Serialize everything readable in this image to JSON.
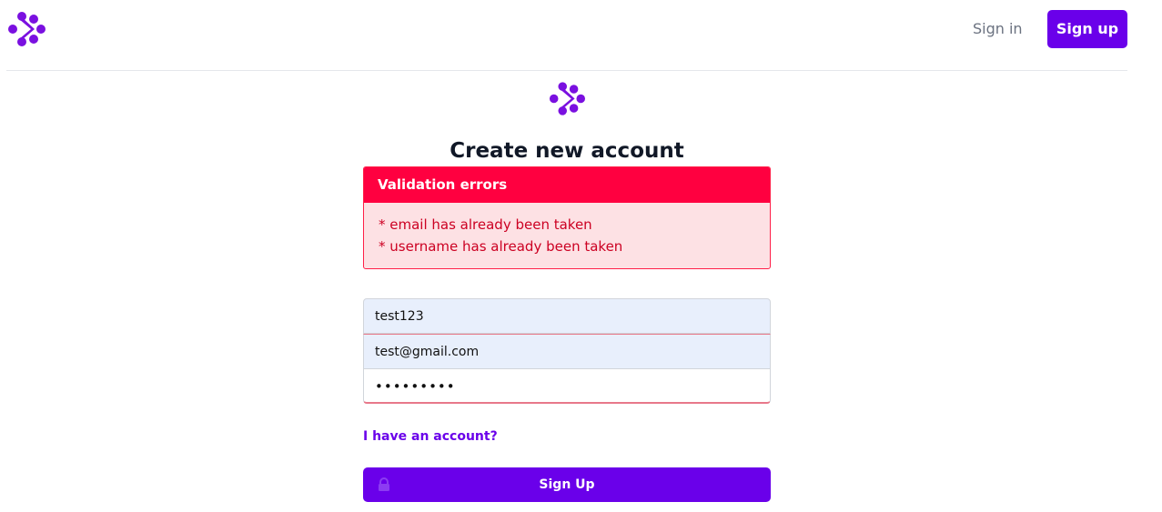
{
  "header": {
    "signin_label": "Sign in",
    "signup_label": "Sign up"
  },
  "page": {
    "title": "Create new account"
  },
  "errors": {
    "title": "Validation errors",
    "items": [
      "* email has already been taken",
      "* username has already been taken"
    ]
  },
  "form": {
    "username_value": "test123",
    "email_value": "test@gmail.com",
    "password_value": "•••••••••",
    "have_account_link": "I have an account?",
    "submit_label": "Sign Up"
  },
  "colors": {
    "brand": "#6a00ea",
    "error": "#ff0040",
    "error_bg": "#fde1e4"
  },
  "icons": {
    "brand_logo": "brand-logo-icon",
    "lock": "lock-icon"
  }
}
